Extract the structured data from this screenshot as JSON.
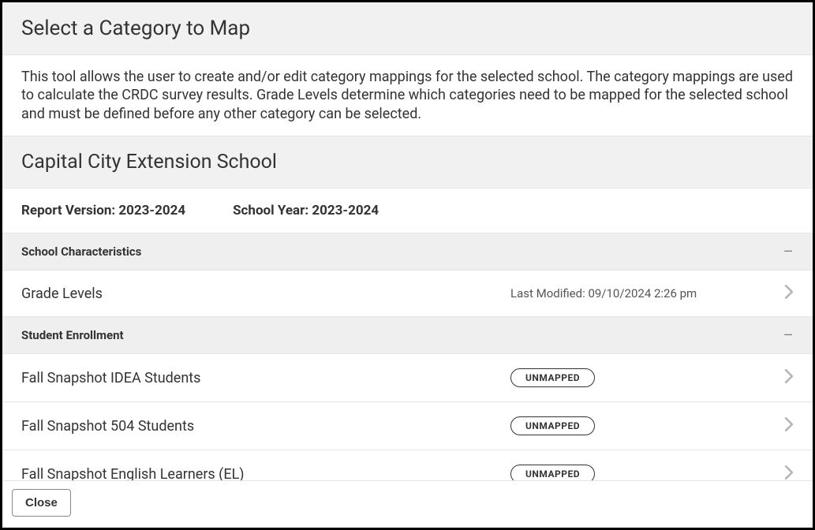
{
  "header": {
    "title": "Select a Category to Map"
  },
  "description": "This tool allows the user to create and/or edit category mappings for the selected school. The category mappings are used to calculate the CRDC survey results. Grade Levels determine which categories need to be mapped for the selected school and must be defined before any other category can be selected.",
  "school": {
    "name": "Capital City Extension School"
  },
  "meta": {
    "report_version_label": "Report Version: 2023-2024",
    "school_year_label": "School Year: 2023-2024"
  },
  "sections": [
    {
      "title": "School Characteristics",
      "rows": [
        {
          "label": "Grade Levels",
          "meta": "Last Modified: 09/10/2024 2:26 pm",
          "badge": null
        }
      ]
    },
    {
      "title": "Student Enrollment",
      "rows": [
        {
          "label": "Fall Snapshot IDEA Students",
          "meta": null,
          "badge": "UNMAPPED"
        },
        {
          "label": "Fall Snapshot 504 Students",
          "meta": null,
          "badge": "UNMAPPED"
        },
        {
          "label": "Fall Snapshot English Learners (EL)",
          "meta": null,
          "badge": "UNMAPPED"
        }
      ]
    }
  ],
  "footer": {
    "close_label": "Close"
  }
}
